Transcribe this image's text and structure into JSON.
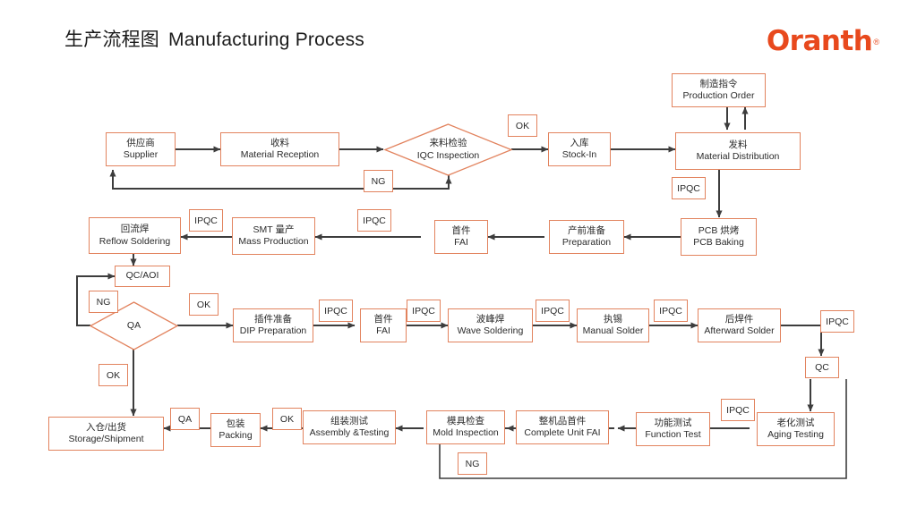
{
  "header": {
    "title_cn": "生产流程图",
    "title_en": "Manufacturing Process",
    "logo_text": "Oranth",
    "logo_mark": "®"
  },
  "colors": {
    "node_border": "#E2835E",
    "logo": "#E8491D",
    "connector": "#404040",
    "text": "#2b2b2b"
  },
  "nodes": {
    "supplier": {
      "cn": "供应商",
      "en": "Supplier"
    },
    "material_reception": {
      "cn": "收料",
      "en": "Material Reception"
    },
    "iqc_inspection": {
      "cn": "来料检验",
      "en": "IQC Inspection"
    },
    "stock_in": {
      "cn": "入库",
      "en": "Stock-In"
    },
    "material_distribution": {
      "cn": "发料",
      "en": "Material Distribution"
    },
    "production_order": {
      "cn": "制造指令",
      "en": "Production Order"
    },
    "pcb_baking": {
      "cn": "PCB 烘烤",
      "en": "PCB Baking"
    },
    "preparation": {
      "cn": "产前准备",
      "en": "Preparation"
    },
    "fai_smt": {
      "cn": "首件",
      "en": "FAI"
    },
    "mass_production": {
      "cn": "SMT 量产",
      "en": "Mass Production"
    },
    "reflow_soldering": {
      "cn": "回流焊",
      "en": "Reflow Soldering"
    },
    "qc_aoi": {
      "cn": "",
      "en": "QC/AOI"
    },
    "qa_decision": {
      "cn": "",
      "en": "QA"
    },
    "dip_preparation": {
      "cn": "插件准备",
      "en": "DIP Preparation"
    },
    "fai_dip": {
      "cn": "首件",
      "en": "FAI"
    },
    "wave_soldering": {
      "cn": "波峰焊",
      "en": "Wave Soldering"
    },
    "manual_solder": {
      "cn": "执锡",
      "en": "Manual Solder"
    },
    "afterward_solder": {
      "cn": "后焊件",
      "en": "Afterward Solder"
    },
    "aging_testing": {
      "cn": "老化测试",
      "en": "Aging Testing"
    },
    "function_test": {
      "cn": "功能测试",
      "en": "Function Test"
    },
    "complete_unit_fai": {
      "cn": "整机品首件",
      "en": "Complete Unit FAI"
    },
    "mold_inspection": {
      "cn": "模具检查",
      "en": "Mold Inspection"
    },
    "assembly_testing": {
      "cn": "组装测试",
      "en": "Assembly &Testing"
    },
    "packing": {
      "cn": "包装",
      "en": "Packing"
    },
    "storage_shipment": {
      "cn": "入仓/出货",
      "en": "Storage/Shipment"
    }
  },
  "tags": {
    "ok_iqc": "OK",
    "ng_iqc": "NG",
    "ipqc_dist": "IPQC",
    "ipqc_reflow": "IPQC",
    "ipqc_smt": "IPQC",
    "ng_qa": "NG",
    "ok_qa_right": "OK",
    "ok_qa_down": "OK",
    "ipqc_dip": "IPQC",
    "ipqc_fai": "IPQC",
    "ipqc_wave": "IPQC",
    "ipqc_manual": "IPQC",
    "ipqc_after": "IPQC",
    "qc_after": "QC",
    "ipqc_aging": "IPQC",
    "ng_mold": "NG",
    "ok_assembly": "OK",
    "qa_packing": "QA"
  }
}
